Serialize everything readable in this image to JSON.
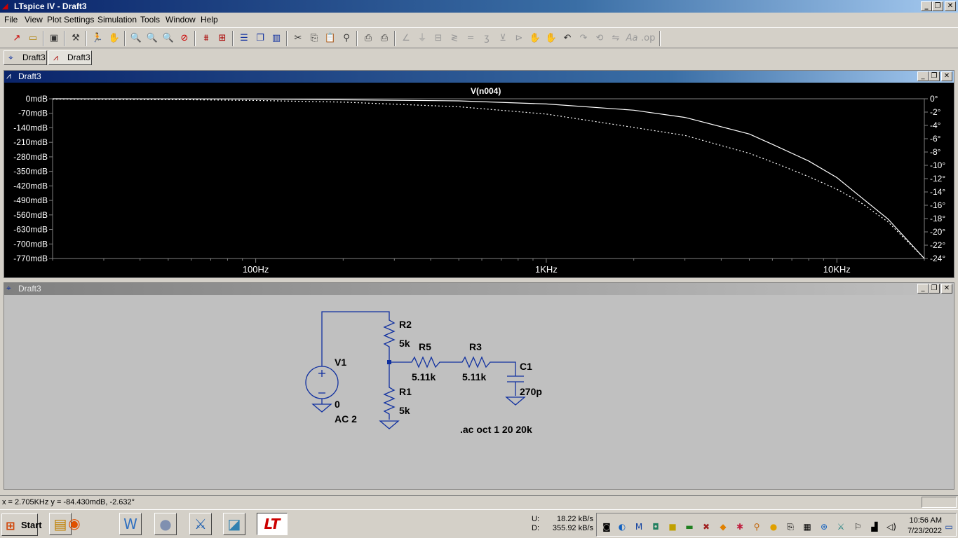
{
  "app": {
    "title": "LTspice IV - Draft3",
    "min_glyph": "_",
    "max_glyph": "❐",
    "close_glyph": "✕"
  },
  "menu": [
    "File",
    "View",
    "Plot Settings",
    "Simulation",
    "Tools",
    "Window",
    "Help"
  ],
  "toolbar_icons": [
    "new-schematic-icon",
    "open-icon",
    "save-icon",
    "control-panel-icon",
    "run-icon",
    "pan-icon",
    "zoom-in-icon",
    "zoom-area-icon",
    "zoom-out-icon",
    "zoom-cancel-icon",
    "autorange-icon",
    "grid-icon",
    "tile-horizontal-icon",
    "cascade-icon",
    "tile-vertical-icon",
    "cut-icon",
    "copy-icon",
    "paste-icon",
    "find-icon",
    "print-preview-icon",
    "print-icon",
    "draw-wire-icon",
    "ground-icon",
    "label-net-icon",
    "resistor-icon",
    "capacitor-icon",
    "inductor-icon",
    "diode-icon",
    "component-icon",
    "move-icon",
    "drag-icon",
    "undo-icon",
    "redo-icon",
    "rotate-icon",
    "mirror-icon",
    "text-icon",
    "spice-directive-icon"
  ],
  "tabs": [
    {
      "label": "Draft3",
      "icon": "schematic-icon"
    },
    {
      "label": "Draft3",
      "icon": "waveform-icon"
    }
  ],
  "plot_window": {
    "title": "Draft3",
    "trace_label": "V(n004)",
    "left_ticks": [
      "0mdB",
      "-70mdB",
      "-140mdB",
      "-210mdB",
      "-280mdB",
      "-350mdB",
      "-420mdB",
      "-490mdB",
      "-560mdB",
      "-630mdB",
      "-700mdB",
      "-770mdB"
    ],
    "right_ticks": [
      "0°",
      "-2°",
      "-4°",
      "-6°",
      "-8°",
      "-10°",
      "-12°",
      "-14°",
      "-16°",
      "-18°",
      "-20°",
      "-22°",
      "-24°"
    ],
    "x_ticks": [
      "100Hz",
      "1KHz",
      "10KHz"
    ]
  },
  "chart_data": {
    "type": "line",
    "title": "V(n004)",
    "x_scale": "log",
    "xlim": [
      20,
      20000
    ],
    "ylim_left": [
      -770,
      0
    ],
    "ylim_right": [
      -24,
      0
    ],
    "x_ticks": [
      "100Hz",
      "1KHz",
      "10KHz"
    ],
    "series": [
      {
        "axis": "left",
        "style": "solid",
        "x": [
          20,
          100,
          500,
          1000,
          2000,
          3000,
          5000,
          6000,
          8000,
          10000,
          12000,
          15000,
          20000
        ],
        "y": [
          0,
          -1,
          -10,
          -25,
          -55,
          -90,
          -170,
          -220,
          -300,
          -380,
          -470,
          -580,
          -770
        ]
      },
      {
        "axis": "right",
        "style": "dotted",
        "x": [
          20,
          50,
          100,
          200,
          500,
          1000,
          2000,
          3000,
          5000,
          6000,
          8000,
          10000,
          12000,
          15000,
          20000
        ],
        "y": [
          -0.05,
          -0.12,
          -0.25,
          -0.5,
          -1.2,
          -2.3,
          -4.3,
          -5.5,
          -8.2,
          -9.5,
          -11.7,
          -13.6,
          -15.5,
          -18.5,
          -24
        ]
      }
    ]
  },
  "schematic_window": {
    "title": "Draft3",
    "components": {
      "v1_name": "V1",
      "v1_value": "0",
      "v1_ac": "AC 2",
      "r1_name": "R1",
      "r1_value": "5k",
      "r2_name": "R2",
      "r2_value": "5k",
      "r5_name": "R5",
      "r5_value": "5.11k",
      "r3_name": "R3",
      "r3_value": "5.11k",
      "c1_name": "C1",
      "c1_value": "270p"
    },
    "directive": ".ac oct 1 20 20k"
  },
  "status": {
    "cursor": "x = 2.705KHz    y = -84.430mdB, -2.632°"
  },
  "taskbar": {
    "start_label": "Start",
    "net_up_label": "U:",
    "net_up": "18.22 kB/s",
    "net_down_label": "D:",
    "net_down": "355.92 kB/s",
    "time": "10:56 AM",
    "date": "7/23/2022"
  }
}
